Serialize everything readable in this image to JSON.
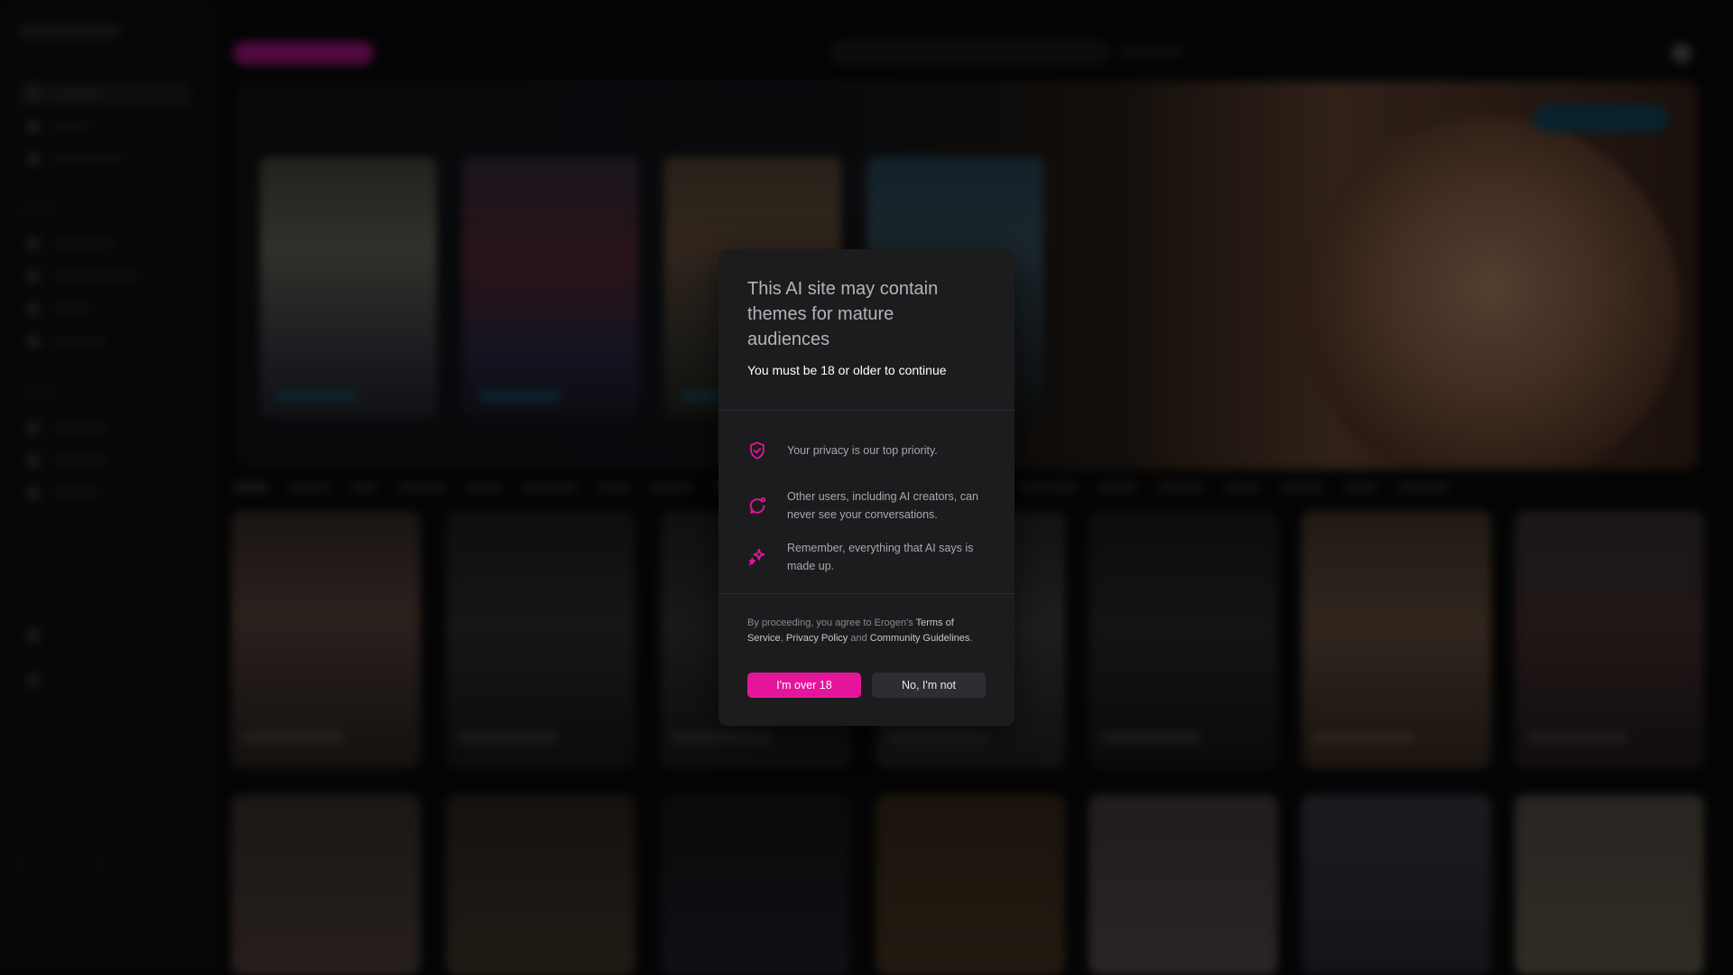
{
  "modal": {
    "title": "This AI site may contain themes for mature audiences",
    "subtitle": "You must be 18 or older to continue",
    "points": [
      {
        "icon": "shield-check-icon",
        "text": "Your privacy is our top priority."
      },
      {
        "icon": "chat-bubble-icon",
        "text": "Other users, including AI creators, can never see your conversations."
      },
      {
        "icon": "sparkles-icon",
        "text": "Remember, everything that AI says is made up."
      }
    ],
    "legal": {
      "prefix": "By proceeding, you agree to Erogen's ",
      "terms": "Terms of Service",
      "comma": ", ",
      "privacy": "Privacy Policy",
      "and": " and ",
      "guidelines": "Community Guidelines",
      "suffix": "."
    },
    "confirm_label": "I'm over 18",
    "decline_label": "No, I'm not"
  },
  "colors": {
    "accent": "#e5159b",
    "modal_bg": "#1c1c1e",
    "decline_bg": "#2e2e32"
  }
}
